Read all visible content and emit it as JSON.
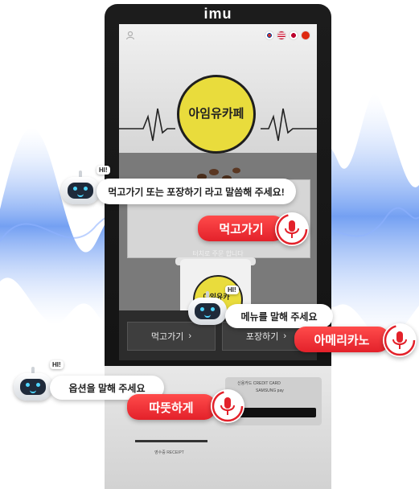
{
  "colors": {
    "accent_red": "#e3212a",
    "wave_blue": "#5b8ff0",
    "logo_yellow": "#e9dc3c",
    "kiosk_body": "#1a1a1a"
  },
  "kiosk": {
    "brand": "imu",
    "logo_text": "아임유카페",
    "touch_note": "터치로 주문 합니다",
    "cup_logo_text": "아임유카",
    "buttons": {
      "takeout": "먹고가기",
      "packaging": "포장하기",
      "chevron": "›"
    },
    "card_label": "신용카드 CREDIT CARD",
    "pay_label": "SAMSUNG pay",
    "receipt_label": "영수증 RECEIPT",
    "icons": [
      "person-icon",
      "flag-korea-icon",
      "flag-usa-icon",
      "flag-japan-icon",
      "flag-china-icon"
    ]
  },
  "voice_prompts": [
    {
      "hi": "HI!",
      "text": "먹고가기 또는 포장하기 라고 말씀해 주세요!"
    },
    {
      "hi": "HI!",
      "text": "메뉴를 말해 주세요"
    },
    {
      "hi": "HI!",
      "text": "옵션을 말해 주세요"
    }
  ],
  "voice_answers": [
    {
      "text": "먹고가기"
    },
    {
      "text": "아메리카노"
    },
    {
      "text": "따뜻하게"
    }
  ]
}
